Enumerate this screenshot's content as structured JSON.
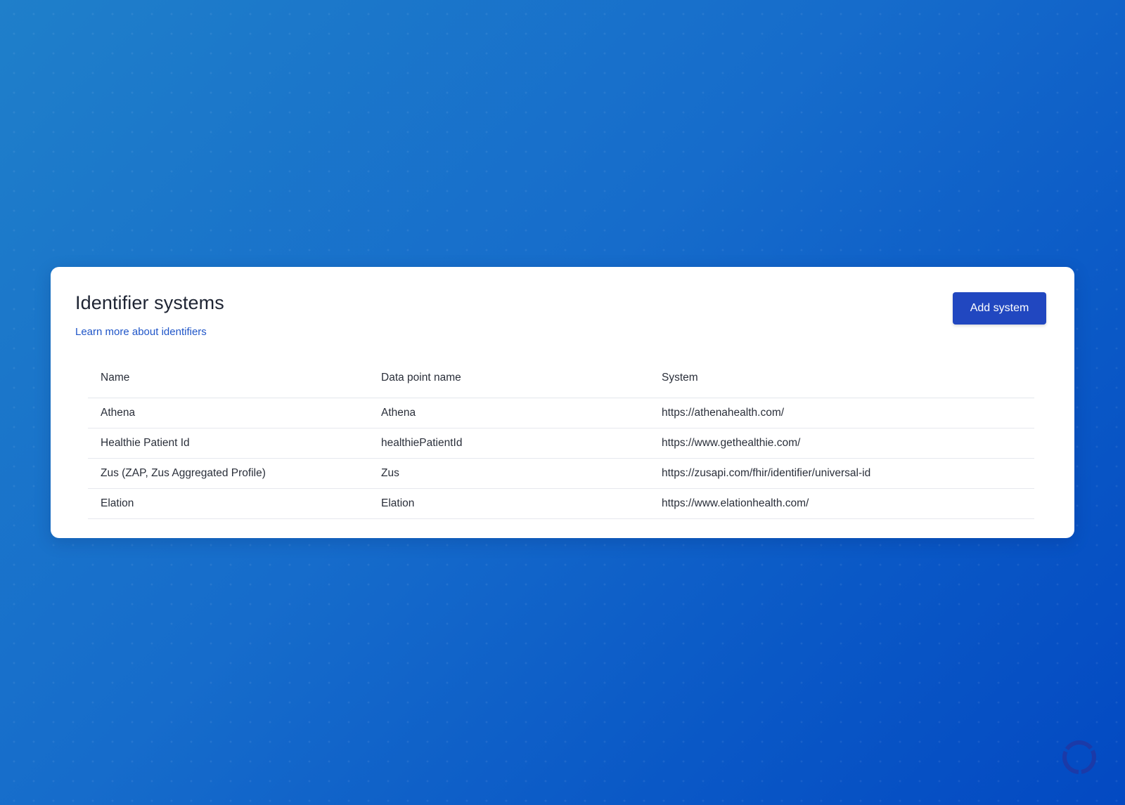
{
  "card": {
    "title": "Identifier systems",
    "learn_link": "Learn more about identifiers",
    "add_button": "Add system"
  },
  "table": {
    "headers": {
      "name": "Name",
      "data_point_name": "Data point name",
      "system": "System"
    },
    "rows": [
      {
        "name": "Athena",
        "data_point_name": "Athena",
        "system": "https://athenahealth.com/"
      },
      {
        "name": "Healthie Patient Id",
        "data_point_name": "healthiePatientId",
        "system": "https://www.gethealthie.com/"
      },
      {
        "name": "Zus (ZAP, Zus Aggregated Profile)",
        "data_point_name": "Zus",
        "system": "https://zusapi.com/fhir/identifier/universal-id"
      },
      {
        "name": "Elation",
        "data_point_name": "Elation",
        "system": "https://www.elationhealth.com/"
      }
    ]
  },
  "loading_indicator": {
    "icon": "loading-spinner-icon",
    "color": "#1b3aa8"
  },
  "colors": {
    "background_start": "#1f7fca",
    "background_end": "#0349c2",
    "accent": "#2147c0",
    "link": "#1f55c8"
  }
}
